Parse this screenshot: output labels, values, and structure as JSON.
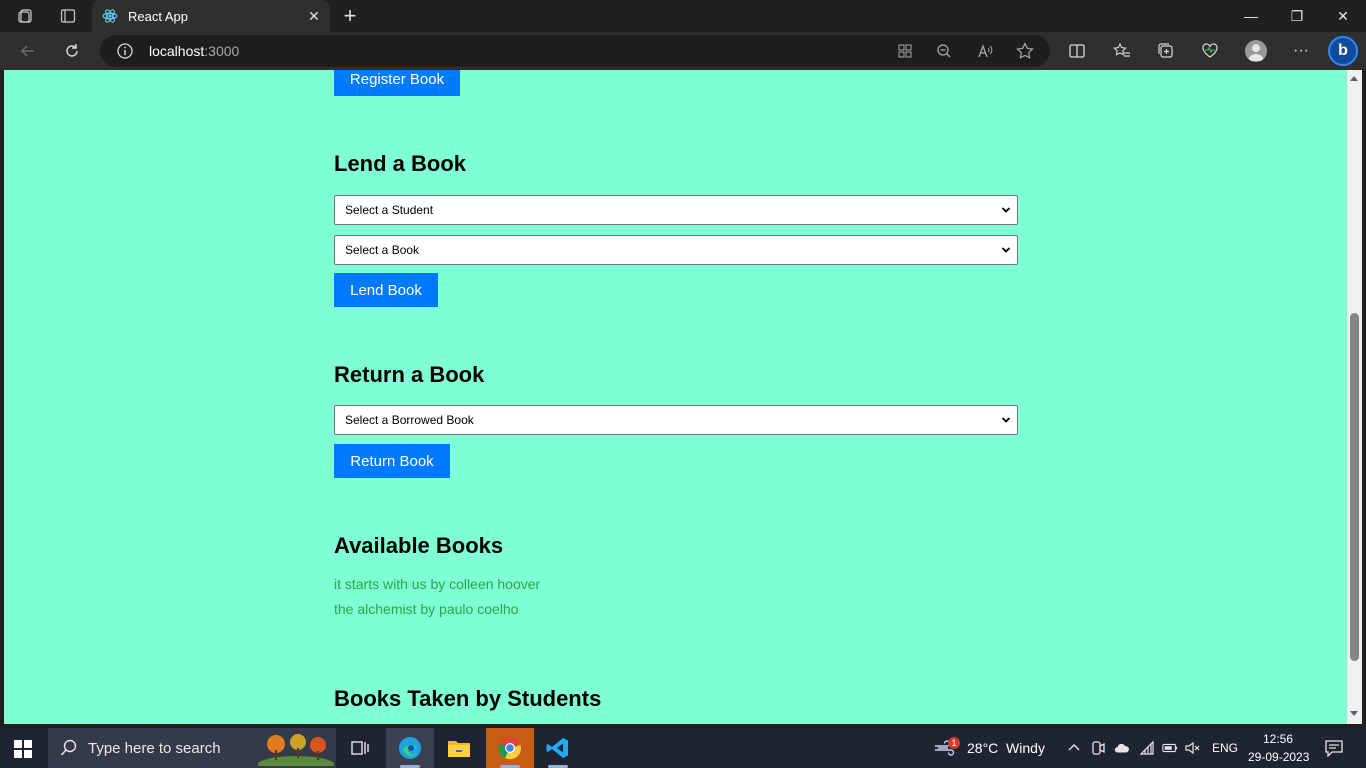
{
  "browser": {
    "tab_title": "React App",
    "url_host": "localhost",
    "url_port": ":3000",
    "close_glyph": "✕",
    "new_tab_glyph": "+",
    "minimize_glyph": "—",
    "restore_glyph": "❐",
    "window_close_glyph": "✕",
    "more_glyph": "···",
    "bing_glyph": "b"
  },
  "page": {
    "background": "#7fffd4",
    "register_button": "Register Book",
    "lend_heading": "Lend a Book",
    "lend_student_select": "Select a Student",
    "lend_book_select": "Select a Book",
    "lend_button": "Lend Book",
    "return_heading": "Return a Book",
    "return_select": "Select a Borrowed Book",
    "return_button": "Return Book",
    "available_heading": "Available Books",
    "available_books": [
      "it starts with us by colleen hoover",
      "the alchemist by paulo coelho"
    ],
    "taken_heading": "Books Taken by Students",
    "accent_button": "#007bff",
    "book_text_color": "#28a745"
  },
  "taskbar": {
    "search_placeholder": "Type here to search",
    "weather_badge": "1",
    "weather": "28°C  Windy",
    "language": "ENG",
    "time": "12:56",
    "date": "29-09-2023"
  }
}
